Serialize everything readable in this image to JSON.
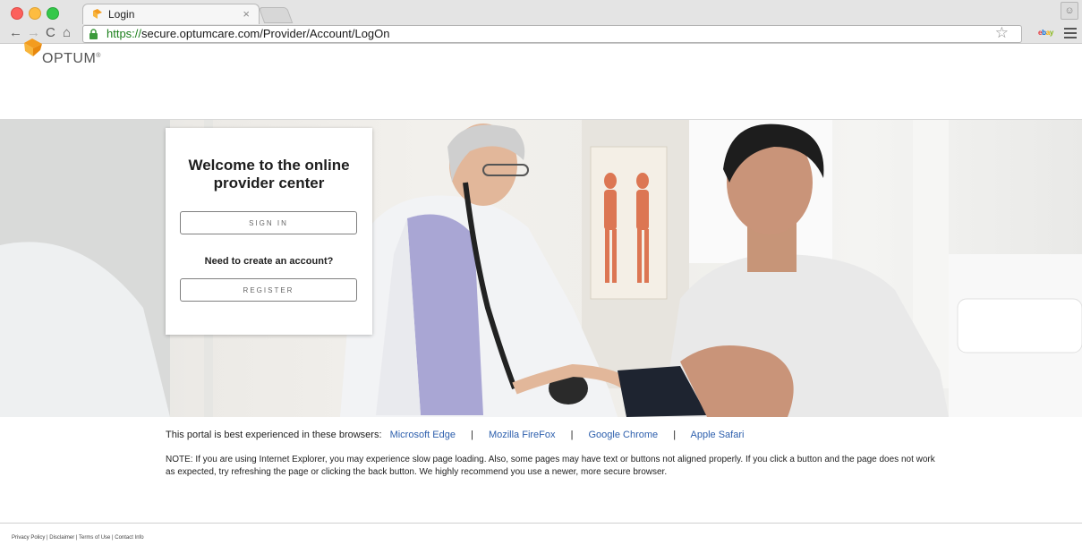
{
  "browser": {
    "tab_title": "Login",
    "tab_close": "×",
    "url_scheme": "https://",
    "url_rest": "secure.optumcare.com/Provider/Account/LogOn",
    "nav_back": "←",
    "nav_forward": "→",
    "nav_reload": "C",
    "nav_home": "⌂",
    "star": "☆",
    "extension_label": "ebay"
  },
  "header": {
    "logo_text": "OPTUM",
    "logo_mark": "®"
  },
  "login_card": {
    "title": "Welcome to the online provider center",
    "signin_label": "SIGN IN",
    "create_account_prompt": "Need to create an account?",
    "register_label": "REGISTER"
  },
  "notice": {
    "intro": "This portal is best experienced in these browsers:",
    "browsers": [
      "Microsoft Edge",
      "Mozilla FireFox",
      "Google Chrome",
      "Apple Safari"
    ],
    "separator": "|",
    "note": "NOTE: If you are using Internet Explorer, you may experience slow page loading. Also, some pages may have text or buttons not aligned properly. If you click a button and the page does not work as expected, try refreshing the page or clicking the back button. We highly recommend you use a newer, more secure browser."
  },
  "footer": {
    "links": "Privacy Policy | Disclaimer | Terms of Use | Contact Info"
  },
  "colors": {
    "brand_orange": "#f39c1f",
    "link_blue": "#2d5fad",
    "https_green": "#1a7f1a"
  }
}
